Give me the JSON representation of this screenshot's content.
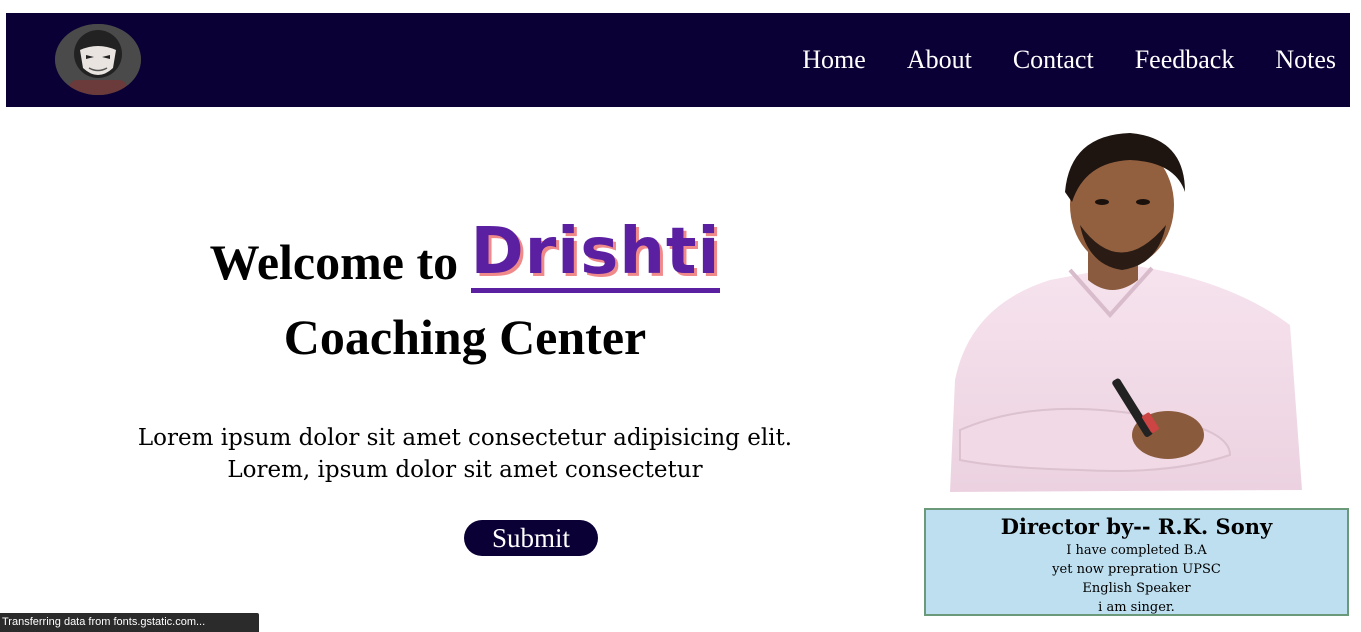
{
  "nav": {
    "logo_icon": "masked-avatar-icon",
    "links": [
      "Home",
      "About",
      "Contact",
      "Feedback",
      "Notes"
    ]
  },
  "hero": {
    "welcome": "Welcome to",
    "brand": "Drishti",
    "line2": "Coaching Center",
    "text_line1": "Lorem ipsum dolor sit amet consectetur adipisicing elit.",
    "text_line2": "Lorem, ipsum dolor sit amet consectetur",
    "submit_label": "Submit"
  },
  "director": {
    "photo_icon": "director-portrait",
    "name": "Director by-- R.K. Sony",
    "lines": [
      "I have completed B.A",
      "yet now prepration UPSC",
      "English Speaker",
      "i am singer."
    ]
  },
  "status": {
    "text": "Transferring data from fonts.gstatic.com..."
  },
  "colors": {
    "navbar_bg": "#0b0036",
    "brand": "#5b1fa1",
    "brand_shadow": "#f08a8a",
    "card_bg": "#bddff0",
    "card_border": "#6b9a7a"
  }
}
